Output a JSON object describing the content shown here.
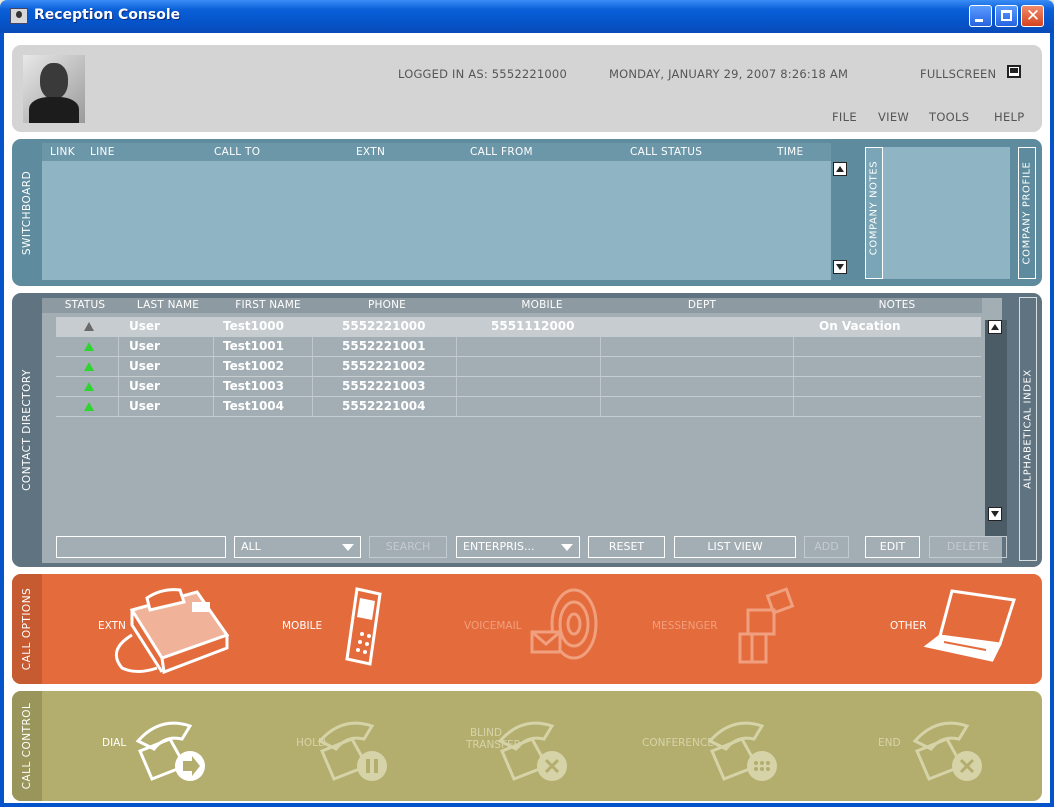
{
  "window": {
    "title": "Reception Console"
  },
  "header": {
    "logged_in": "LOGGED IN AS: 5552221000",
    "datetime": "MONDAY, JANUARY 29, 2007 8:26:18 AM",
    "fullscreen": "FULLSCREEN",
    "menu": [
      "FILE",
      "VIEW",
      "TOOLS",
      "HELP"
    ]
  },
  "switchboard": {
    "label": "SWITCHBOARD",
    "columns": [
      "LINK",
      "LINE",
      "CALL TO",
      "EXTN",
      "CALL FROM",
      "CALL STATUS",
      "TIME"
    ],
    "company_notes_label": "COMPANY NOTES",
    "company_profile_label": "COMPANY PROFILE"
  },
  "directory": {
    "label": "CONTACT DIRECTORY",
    "columns": [
      "STATUS",
      "LAST NAME",
      "FIRST NAME",
      "PHONE",
      "MOBILE",
      "DEPT",
      "NOTES"
    ],
    "rows": [
      {
        "status": "away",
        "last": "User",
        "first": "Test1000",
        "phone": "5552221000",
        "mobile": "5551112000",
        "dept": "",
        "notes": "On Vacation"
      },
      {
        "status": "available",
        "last": "User",
        "first": "Test1001",
        "phone": "5552221001",
        "mobile": "",
        "dept": "",
        "notes": ""
      },
      {
        "status": "available",
        "last": "User",
        "first": "Test1002",
        "phone": "5552221002",
        "mobile": "",
        "dept": "",
        "notes": ""
      },
      {
        "status": "available",
        "last": "User",
        "first": "Test1003",
        "phone": "5552221003",
        "mobile": "",
        "dept": "",
        "notes": ""
      },
      {
        "status": "available",
        "last": "User",
        "first": "Test1004",
        "phone": "5552221004",
        "mobile": "",
        "dept": "",
        "notes": ""
      }
    ],
    "search_value": "",
    "filter_select": "ALL",
    "search_button": "SEARCH",
    "scope_select": "ENTERPRIS...",
    "reset_button": "RESET",
    "listview_button": "LIST VIEW",
    "add_button": "ADD",
    "edit_button": "EDIT",
    "delete_button": "DELETE",
    "alpha_index_label": "ALPHABETICAL INDEX"
  },
  "call_options": {
    "label": "CALL OPTIONS",
    "items": [
      "EXTN",
      "MOBILE",
      "VOICEMAIL",
      "MESSENGER",
      "OTHER"
    ]
  },
  "call_control": {
    "label": "CALL CONTROL",
    "items": [
      "DIAL",
      "HOLD",
      "BLIND",
      "TRANSFER",
      "CONFERENCE",
      "END"
    ]
  },
  "colors": {
    "titlebar": "#0553c8",
    "switchboard": "#5e8c9e",
    "directory": "#5f7380",
    "call_options": "#e46b3c",
    "call_control": "#b3ae6e",
    "status_available": "#2fd52f",
    "status_away": "#6a6a6a"
  }
}
